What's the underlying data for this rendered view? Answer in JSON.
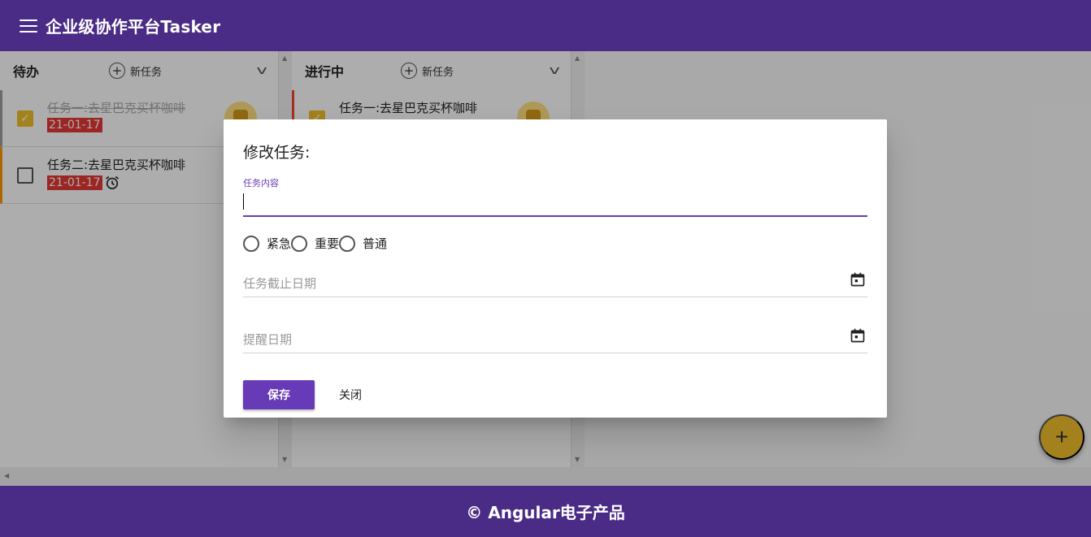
{
  "app": {
    "title": "企业级协作平台Tasker"
  },
  "lists": [
    {
      "name": "待办",
      "add_label": "新任务",
      "tasks": [
        {
          "text": "任务一:去星巴克买杯咖啡",
          "due": "21-01-17",
          "done": true,
          "has_reminder": false,
          "priority": "done"
        },
        {
          "text": "任务二:去星巴克买杯咖啡",
          "due": "21-01-17",
          "done": false,
          "has_reminder": true,
          "priority": "normal"
        }
      ]
    },
    {
      "name": "进行中",
      "add_label": "新任务",
      "tasks": [
        {
          "text": "任务一:去星巴克买杯咖啡",
          "due": "",
          "done": true,
          "has_reminder": false,
          "priority": "urgent"
        }
      ]
    }
  ],
  "fab": {
    "label": "+"
  },
  "footer": {
    "text": "© Angular电子产品"
  },
  "dialog": {
    "title": "修改任务:",
    "content_label": "任务内容",
    "content_value": "",
    "priorities": [
      "紧急",
      "重要",
      "普通"
    ],
    "due_placeholder": "任务截止日期",
    "reminder_placeholder": "提醒日期",
    "save_label": "保存",
    "close_label": "关闭"
  },
  "colors": {
    "primary": "#4a2b85",
    "accent": "#673ab7",
    "fab": "#f0c02b",
    "due_badge": "#e53935"
  },
  "icons": [
    "menu-icon",
    "add-circle-icon",
    "chevron-down-icon",
    "alarm-icon",
    "calendar-icon",
    "avatar"
  ]
}
